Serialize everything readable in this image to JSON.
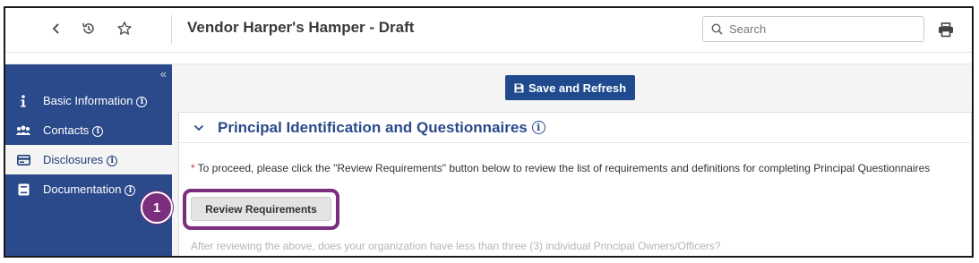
{
  "header": {
    "title": "Vendor Harper's Hamper - Draft",
    "search_placeholder": "Search",
    "back_icon": "chevron-left-icon",
    "history_icon": "history-icon",
    "favorite_icon": "star-icon",
    "print_icon": "printer-icon"
  },
  "sidebar": {
    "collapse_label": "«",
    "items": [
      {
        "label": "Basic Information",
        "info": "i",
        "icon": "info-icon",
        "active": false
      },
      {
        "label": "Contacts",
        "info": "i",
        "icon": "users-icon",
        "active": false
      },
      {
        "label": "Disclosures",
        "info": "i",
        "icon": "card-icon",
        "active": true
      },
      {
        "label": "Documentation",
        "info": "i",
        "icon": "book-icon",
        "active": false
      }
    ]
  },
  "main": {
    "save_button": "Save and Refresh",
    "panel": {
      "title": "Principal Identification and Questionnaires",
      "info": "i",
      "required_mark": "*",
      "note": "To proceed, please click the \"Review Requirements\" button below to review the list of requirements and definitions for completing Principal Questionnaires",
      "review_button": "Review Requirements",
      "question": "After reviewing the above, does your organization have less than three (3) individual Principal Owners/Officers?"
    }
  },
  "callout": {
    "step": "1"
  },
  "colors": {
    "sidebar_bg": "#2b4a8b",
    "primary_button": "#1f4b8e",
    "title_blue": "#2b4a8b",
    "highlight": "#7b2d7e",
    "required": "#dd3333"
  }
}
